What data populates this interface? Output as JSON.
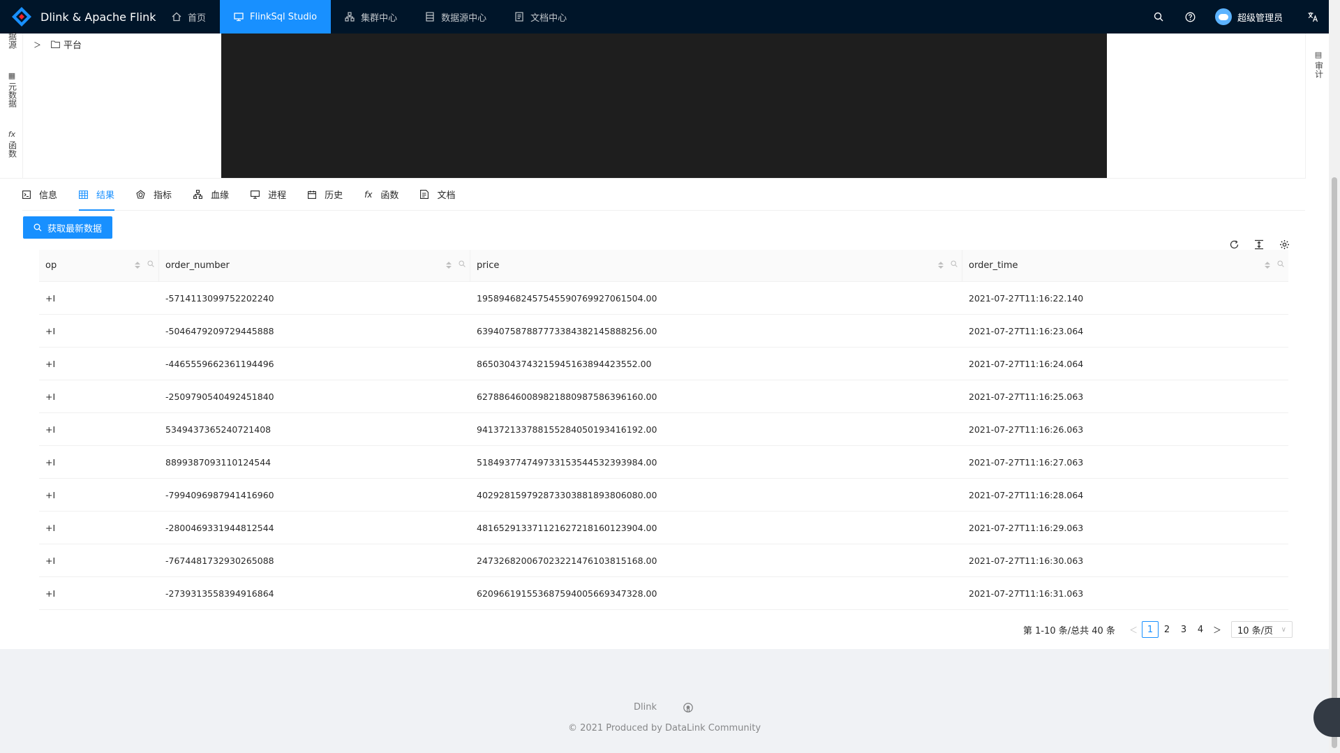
{
  "header": {
    "title": "Dlink & Apache Flink",
    "nav": [
      {
        "label": "首页",
        "icon": "home-icon"
      },
      {
        "label": "FlinkSql Studio",
        "icon": "desktop-icon",
        "active": true
      },
      {
        "label": "集群中心",
        "icon": "cluster-icon"
      },
      {
        "label": "数据源中心",
        "icon": "database-icon"
      },
      {
        "label": "文档中心",
        "icon": "document-icon"
      }
    ],
    "user_name": "超级管理员"
  },
  "left_tabs": [
    {
      "label": "据源",
      "icon": "database-icon"
    },
    {
      "label": "元数据",
      "icon": "table-icon"
    },
    {
      "label": "函数",
      "icon": "function-icon"
    }
  ],
  "tree": {
    "root_label": "平台"
  },
  "right_tabs": [
    {
      "label": "审计",
      "icon": "audit-icon"
    }
  ],
  "bottom_tabs": [
    {
      "label": "信息",
      "icon": "terminal-icon"
    },
    {
      "label": "结果",
      "icon": "table-icon",
      "active": true
    },
    {
      "label": "指标",
      "icon": "radar-icon"
    },
    {
      "label": "血缘",
      "icon": "lineage-icon"
    },
    {
      "label": "进程",
      "icon": "desktop-icon"
    },
    {
      "label": "历史",
      "icon": "calendar-icon"
    },
    {
      "label": "函数",
      "icon": "function-icon"
    },
    {
      "label": "文档",
      "icon": "doc-icon"
    }
  ],
  "fetch_button": {
    "label": "获取最新数据"
  },
  "table": {
    "columns": [
      "op",
      "order_number",
      "price",
      "order_time"
    ],
    "rows": [
      [
        "+I",
        "-5714113099752202240",
        "19589468245754559076992706150 4.00",
        "2021-07-27T11:16:22.140"
      ],
      [
        "+I",
        "-5046479209729445888",
        "639407587887773384382145888256.00",
        "2021-07-27T11:16:23.064"
      ],
      [
        "+I",
        "-4465559662361194496",
        "865030437432159451638944235 52.00",
        "2021-07-27T11:16:24.064"
      ],
      [
        "+I",
        "-2509790540492451840",
        "627886460089821880987586396160.00",
        "2021-07-27T11:16:25.063"
      ],
      [
        "+I",
        "5349437365240721408",
        "941372133788155284050193416192.00",
        "2021-07-27T11:16:26.063"
      ],
      [
        "+I",
        "8899387093110124544",
        "518493774749733153544532393984.00",
        "2021-07-27T11:16:27.063"
      ],
      [
        "+I",
        "-7994096987941416960",
        "402928159792873303881893806080.00",
        "2021-07-27T11:16:28.064"
      ],
      [
        "+I",
        "-2800469331944812544",
        "481652913371121627218160123904.00",
        "2021-07-27T11:16:29.063"
      ],
      [
        "+I",
        "-7674481732930265088",
        "247326820067023221476103815168.00",
        "2021-07-27T11:16:30.063"
      ],
      [
        "+I",
        "-2739313558394916864",
        "620966191553687594005669347328.00",
        "2021-07-27T11:16:31.063"
      ]
    ]
  },
  "pagination": {
    "total_text": "第 1-10 条/总共 40 条",
    "pages": [
      "1",
      "2",
      "3",
      "4"
    ],
    "current": "1",
    "page_size": "10 条/页"
  },
  "footer": {
    "link": "Dlink",
    "copyright": "2021 Produced by DataLink Community"
  },
  "colors": {
    "primary": "#1890ff",
    "header_bg": "#001529",
    "editor_bg": "#1e1e1e"
  }
}
